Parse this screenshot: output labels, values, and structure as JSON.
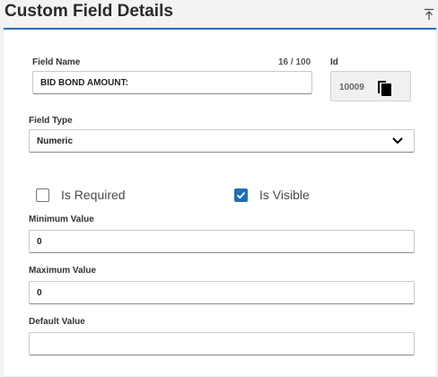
{
  "header": {
    "title": "Custom Field Details"
  },
  "form": {
    "field_name": {
      "label": "Field Name",
      "counter": "16 / 100",
      "value": "BID BOND AMOUNT:"
    },
    "id": {
      "label": "Id",
      "value": "10009"
    },
    "field_type": {
      "label": "Field Type",
      "value": "Numeric"
    },
    "is_required": {
      "label": "Is Required",
      "checked": false
    },
    "is_visible": {
      "label": "Is Visible",
      "checked": true
    },
    "minimum_value": {
      "label": "Minimum Value",
      "value": "0"
    },
    "maximum_value": {
      "label": "Maximum Value",
      "value": "0"
    },
    "default_value": {
      "label": "Default Value",
      "value": ""
    }
  },
  "colors": {
    "accent": "#2a6ebb",
    "checkbox_checked": "#1f6fb5"
  },
  "icons": [
    "collapse-up-icon",
    "copy-icon",
    "chevron-down-icon",
    "checkmark-icon"
  ]
}
